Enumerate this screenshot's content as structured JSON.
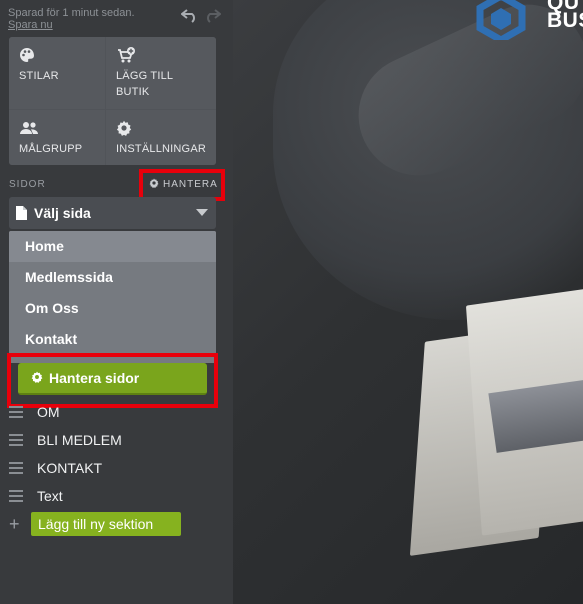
{
  "autosave": {
    "status": "Sparad för 1 minut sedan.",
    "save_link": "Spara nu"
  },
  "tiles": [
    {
      "label": "STILAR",
      "icon": "palette-icon"
    },
    {
      "label": "LÄGG TILL BUTIK",
      "icon": "add-shop-icon"
    },
    {
      "label": "MÅLGRUPP",
      "icon": "people-icon"
    },
    {
      "label": "INSTÄLLNINGAR",
      "icon": "gear-icon"
    }
  ],
  "pages": {
    "section_label": "SIDOR",
    "manage_label": "HANTERA",
    "select_placeholder": "Välj sida",
    "items": [
      "Home",
      "Medlemssida",
      "Om Oss",
      "Kontakt"
    ],
    "manage_button": "Hantera sidor"
  },
  "sections": [
    "OM",
    "BLI MEDLEM",
    "KONTAKT",
    "Text"
  ],
  "add_section": "Lägg till ny sektion",
  "logo_text": [
    "QU",
    "BUS"
  ],
  "colors": {
    "highlight": "#e8000b",
    "accent_green": "#7aa51c",
    "logo_blue": "#2f6fb3"
  }
}
